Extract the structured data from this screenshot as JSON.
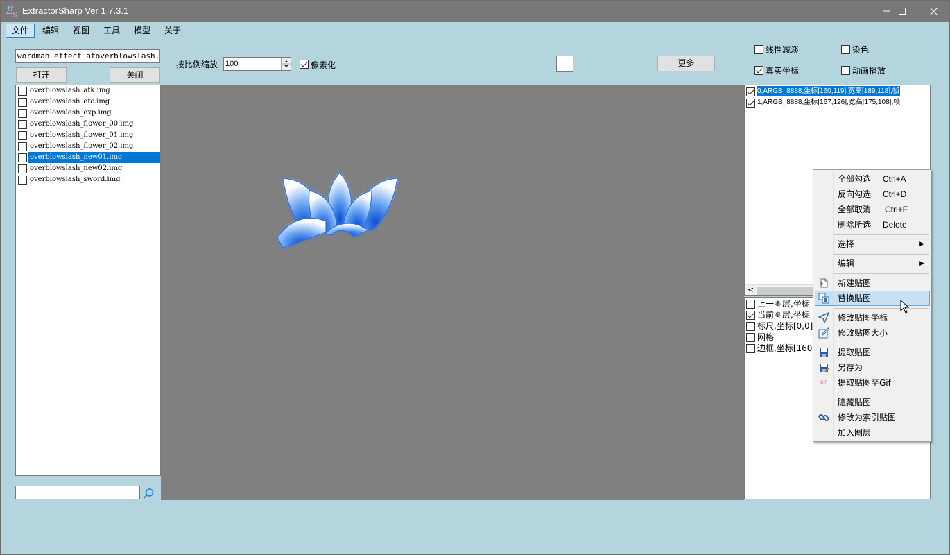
{
  "window": {
    "title": "ExtractorSharp Ver 1.7.3.1"
  },
  "menu": [
    "文件",
    "编辑",
    "视图",
    "工具",
    "模型",
    "关于"
  ],
  "npk": {
    "path_value": "wordman_effect_atoverblowslash.NPK",
    "open_label": "打开",
    "close_label": "关闭"
  },
  "toolbar": {
    "scale_label": "按比例缩放",
    "scale_value": "100",
    "pixelate_label": "像素化",
    "pixelate_checked": true,
    "more_label": "更多"
  },
  "options": {
    "linear_fade": {
      "label": "线性减淡",
      "checked": false
    },
    "dye": {
      "label": "染色",
      "checked": false
    },
    "real_coords": {
      "label": "真实坐标",
      "checked": true
    },
    "animate": {
      "label": "动画播放",
      "checked": false
    }
  },
  "files": [
    {
      "name": "overblowslash_atk.img",
      "checked": false,
      "selected": false
    },
    {
      "name": "overblowslash_etc.img",
      "checked": false,
      "selected": false
    },
    {
      "name": "overblowslash_exp.img",
      "checked": false,
      "selected": false
    },
    {
      "name": "overblowslash_flower_00.img",
      "checked": false,
      "selected": false
    },
    {
      "name": "overblowslash_flower_01.img",
      "checked": false,
      "selected": false
    },
    {
      "name": "overblowslash_flower_02.img",
      "checked": false,
      "selected": false
    },
    {
      "name": "overblowslash_new01.img",
      "checked": false,
      "selected": true
    },
    {
      "name": "overblowslash_new02.img",
      "checked": false,
      "selected": false
    },
    {
      "name": "overblowslash_sword.img",
      "checked": false,
      "selected": false
    }
  ],
  "search": {
    "value": ""
  },
  "frames": [
    {
      "text": "0,ARGB_8888,坐标[160,119],宽高[189,118],帧",
      "checked": true,
      "selected": true
    },
    {
      "text": "1,ARGB_8888,坐标[167,126],宽高[175,108],帧",
      "checked": true,
      "selected": false
    }
  ],
  "layers": [
    {
      "text": "上一图层,坐标",
      "checked": false
    },
    {
      "text": "当前图层,坐标",
      "checked": true
    },
    {
      "text": "标尺,坐标[0,0]",
      "checked": false
    },
    {
      "text": "网格",
      "checked": false
    },
    {
      "text": "边框,坐标[160,",
      "checked": false
    }
  ],
  "scroll_left_arrow": "<",
  "context_menu": [
    {
      "label": "全部勾选",
      "shortcut": "Ctrl+A",
      "icon": ""
    },
    {
      "label": "反向勾选",
      "shortcut": "Ctrl+D",
      "icon": ""
    },
    {
      "label": "全部取消",
      "shortcut": "Ctrl+F",
      "icon": ""
    },
    {
      "label": "删除所选",
      "shortcut": "Delete",
      "icon": ""
    },
    {
      "label": "选择",
      "submenu": true,
      "icon": ""
    },
    {
      "label": "编辑",
      "submenu": true,
      "icon": ""
    },
    {
      "label": "新建贴图",
      "icon": "new-image-icon"
    },
    {
      "label": "替换贴图",
      "icon": "replace-image-icon",
      "highlighted": true
    },
    {
      "label": "修改贴图坐标",
      "icon": "move-arrow-icon"
    },
    {
      "label": "修改贴图大小",
      "icon": "edit-pencil-icon"
    },
    {
      "label": "提取贴图",
      "icon": "save-icon"
    },
    {
      "label": "另存为",
      "icon": "save-as-icon"
    },
    {
      "label": "提取贴图至Gif",
      "icon": "gif-icon",
      "icon_text": "GIF"
    },
    {
      "label": "隐藏贴图",
      "icon": ""
    },
    {
      "label": "修改为索引贴图",
      "icon": "link-icon"
    },
    {
      "label": "加入图层",
      "icon": ""
    }
  ],
  "colors": {
    "background": "#b4d5de",
    "titlebar": "#787878",
    "selection": "#0078d7",
    "canvas": "#808080",
    "menu_highlight": "#c8e0f4"
  }
}
